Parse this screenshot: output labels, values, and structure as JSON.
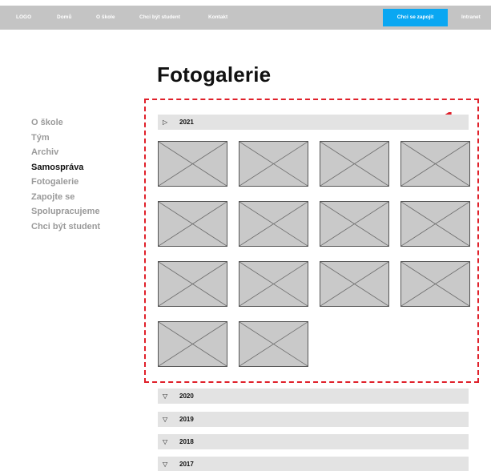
{
  "header": {
    "logo": "LOGO",
    "nav": [
      "Domů",
      "O škole",
      "Chci být student",
      "Kontakt"
    ],
    "cta_label": "Chci se zapojit",
    "intranet_label": "Intranet"
  },
  "page": {
    "title": "Fotogalerie",
    "annotation_number": "1"
  },
  "sidebar": {
    "items": [
      {
        "label": "O škole",
        "active": false
      },
      {
        "label": "Tým",
        "active": false
      },
      {
        "label": "Archiv",
        "active": false
      },
      {
        "label": "Samospráva",
        "active": true
      },
      {
        "label": "Fotogalerie",
        "active": false
      },
      {
        "label": "Zapojte se",
        "active": false
      },
      {
        "label": "Spolupracujeme",
        "active": false
      },
      {
        "label": "Chci být student",
        "active": false
      }
    ]
  },
  "gallery": {
    "years": [
      {
        "year": "2021",
        "expanded": true,
        "icon": "triangle-right-icon",
        "arrow": "▷",
        "photo_count": 14
      },
      {
        "year": "2020",
        "expanded": false,
        "icon": "triangle-down-icon",
        "arrow": "▽"
      },
      {
        "year": "2019",
        "expanded": false,
        "icon": "triangle-down-icon",
        "arrow": "▽"
      },
      {
        "year": "2018",
        "expanded": false,
        "icon": "triangle-down-icon",
        "arrow": "▽"
      },
      {
        "year": "2017",
        "expanded": false,
        "icon": "triangle-down-icon",
        "arrow": "▽"
      }
    ]
  },
  "colors": {
    "topbar": "#c4c4c4",
    "cta": "#0aa7f2",
    "annotation": "#e0202a",
    "year_row": "#e3e3e3",
    "placeholder": "#c9c9c9"
  }
}
